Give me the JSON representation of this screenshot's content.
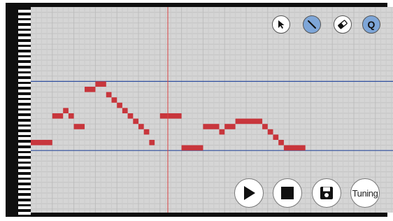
{
  "toolbar": {
    "tools": [
      {
        "name": "select-tool",
        "icon": "cursor-arrow-icon",
        "active": false
      },
      {
        "name": "draw-tool",
        "icon": "pencil-line-icon",
        "active": true
      },
      {
        "name": "erase-tool",
        "icon": "eraser-icon",
        "active": false
      },
      {
        "name": "quantize-tool",
        "icon": "quantize-icon",
        "label": "Q",
        "active": true
      }
    ]
  },
  "transport": {
    "play": {
      "icon": "play-icon"
    },
    "stop": {
      "icon": "stop-icon"
    },
    "save": {
      "icon": "floppy-disk-icon"
    },
    "tuning_label": "Tuning"
  },
  "colors": {
    "grid_background": "#d5d5d5",
    "note": "#c8363c",
    "range_line": "#2f4f9f",
    "playhead": "#d94444",
    "active_tool": "#7ea6d8"
  },
  "notes": [
    {
      "start": 0,
      "length": 4,
      "pitch": 36
    },
    {
      "start": 4,
      "length": 2,
      "pitch": 41
    },
    {
      "start": 6,
      "length": 1,
      "pitch": 42
    },
    {
      "start": 7,
      "length": 1,
      "pitch": 41
    },
    {
      "start": 8,
      "length": 2,
      "pitch": 39
    },
    {
      "start": 10,
      "length": 2,
      "pitch": 46
    },
    {
      "start": 12,
      "length": 2,
      "pitch": 47
    },
    {
      "start": 14,
      "length": 1,
      "pitch": 45
    },
    {
      "start": 15,
      "length": 1,
      "pitch": 44
    },
    {
      "start": 16,
      "length": 1,
      "pitch": 43
    },
    {
      "start": 17,
      "length": 1,
      "pitch": 42
    },
    {
      "start": 18,
      "length": 1,
      "pitch": 41
    },
    {
      "start": 19,
      "length": 1,
      "pitch": 40
    },
    {
      "start": 20,
      "length": 1,
      "pitch": 39
    },
    {
      "start": 21,
      "length": 1,
      "pitch": 38
    },
    {
      "start": 22,
      "length": 1,
      "pitch": 36
    },
    {
      "start": 24,
      "length": 4,
      "pitch": 41
    },
    {
      "start": 28,
      "length": 4,
      "pitch": 35
    },
    {
      "start": 32,
      "length": 3,
      "pitch": 39
    },
    {
      "start": 35,
      "length": 1,
      "pitch": 38
    },
    {
      "start": 36,
      "length": 2,
      "pitch": 39
    },
    {
      "start": 38,
      "length": 5,
      "pitch": 40
    },
    {
      "start": 43,
      "length": 1,
      "pitch": 39
    },
    {
      "start": 44,
      "length": 1,
      "pitch": 38
    },
    {
      "start": 45,
      "length": 1,
      "pitch": 37
    },
    {
      "start": 46,
      "length": 1,
      "pitch": 36
    },
    {
      "start": 47,
      "length": 4,
      "pitch": 35
    }
  ]
}
